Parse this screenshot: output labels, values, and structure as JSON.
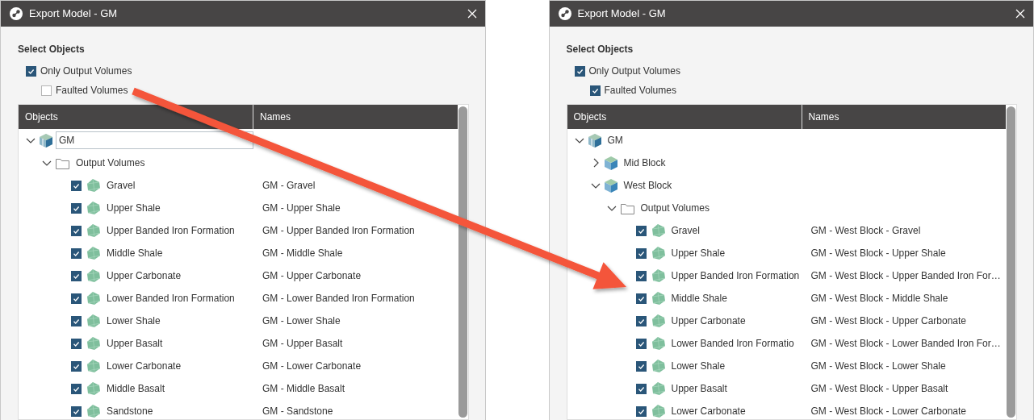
{
  "dialogs": [
    {
      "title": "Export Model - GM",
      "section": "Select Objects",
      "options": [
        {
          "label": "Only Output Volumes",
          "checked": true,
          "children": [
            {
              "label": "Faulted Volumes",
              "checked": false
            }
          ]
        }
      ],
      "columns": [
        "Objects",
        "Names"
      ],
      "tree": [
        {
          "kind": "model",
          "label": "GM",
          "expanded": true,
          "selected": true,
          "children": [
            {
              "kind": "folder",
              "label": "Output Volumes",
              "expanded": true,
              "selected": false,
              "children": [
                {
                  "kind": "volume",
                  "label": "Gravel",
                  "name": "GM - Gravel",
                  "checked": true,
                  "selected": false
                },
                {
                  "kind": "volume",
                  "label": "Upper Shale",
                  "name": "GM - Upper Shale",
                  "checked": true,
                  "selected": false
                },
                {
                  "kind": "volume",
                  "label": "Upper Banded Iron Formation",
                  "name": "GM - Upper Banded Iron Formation",
                  "checked": true,
                  "selected": false
                },
                {
                  "kind": "volume",
                  "label": "Middle Shale",
                  "name": "GM - Middle Shale",
                  "checked": true,
                  "selected": false
                },
                {
                  "kind": "volume",
                  "label": "Upper Carbonate",
                  "name": "GM - Upper Carbonate",
                  "checked": true,
                  "selected": false
                },
                {
                  "kind": "volume",
                  "label": "Lower Banded Iron Formation",
                  "name": "GM - Lower Banded Iron Formation",
                  "checked": true,
                  "selected": false
                },
                {
                  "kind": "volume",
                  "label": "Lower Shale",
                  "name": "GM - Lower Shale",
                  "checked": true,
                  "selected": false
                },
                {
                  "kind": "volume",
                  "label": "Upper Basalt",
                  "name": "GM - Upper Basalt",
                  "checked": true,
                  "selected": false
                },
                {
                  "kind": "volume",
                  "label": "Lower Carbonate",
                  "name": "GM - Lower Carbonate",
                  "checked": true,
                  "selected": false
                },
                {
                  "kind": "volume",
                  "label": "Middle Basalt",
                  "name": "GM - Middle Basalt",
                  "checked": true,
                  "selected": false
                },
                {
                  "kind": "volume",
                  "label": "Sandstone",
                  "name": "GM - Sandstone",
                  "checked": true,
                  "selected": false
                }
              ]
            }
          ]
        }
      ]
    },
    {
      "title": "Export Model - GM",
      "section": "Select Objects",
      "options": [
        {
          "label": "Only Output Volumes",
          "checked": true,
          "children": [
            {
              "label": "Faulted Volumes",
              "checked": true
            }
          ]
        }
      ],
      "columns": [
        "Objects",
        "Names"
      ],
      "tree": [
        {
          "kind": "model",
          "label": "GM",
          "expanded": true,
          "selected": false,
          "children": [
            {
              "kind": "block",
              "label": "Mid Block",
              "expanded": false,
              "selected": false
            },
            {
              "kind": "block",
              "label": "West Block",
              "expanded": true,
              "selected": false,
              "children": [
                {
                  "kind": "folder",
                  "label": "Output Volumes",
                  "expanded": true,
                  "selected": false,
                  "children": [
                    {
                      "kind": "volume",
                      "label": "Gravel",
                      "name": "GM - West Block - Gravel",
                      "checked": true,
                      "selected": false
                    },
                    {
                      "kind": "volume",
                      "label": "Upper Shale",
                      "name": "GM - West Block - Upper Shale",
                      "checked": true,
                      "selected": false
                    },
                    {
                      "kind": "volume",
                      "label": "Upper Banded Iron Formation",
                      "name": "GM - West Block - Upper Banded Iron For…",
                      "checked": true,
                      "selected": false
                    },
                    {
                      "kind": "volume",
                      "label": "Middle Shale",
                      "name": "GM - West Block - Middle Shale",
                      "checked": true,
                      "selected": false
                    },
                    {
                      "kind": "volume",
                      "label": "Upper Carbonate",
                      "name": "GM - West Block - Upper Carbonate",
                      "checked": true,
                      "selected": false
                    },
                    {
                      "kind": "volume",
                      "label": "Lower Banded Iron Formatio",
                      "name": "GM - West Block - Lower Banded Iron For…",
                      "checked": true,
                      "selected": false
                    },
                    {
                      "kind": "volume",
                      "label": "Lower Shale",
                      "name": "GM - West Block - Lower Shale",
                      "checked": true,
                      "selected": false
                    },
                    {
                      "kind": "volume",
                      "label": "Upper Basalt",
                      "name": "GM - West Block - Upper Basalt",
                      "checked": true,
                      "selected": false
                    },
                    {
                      "kind": "volume",
                      "label": "Lower Carbonate",
                      "name": "GM - West Block - Lower Carbonate",
                      "checked": true,
                      "selected": false
                    }
                  ]
                }
              ]
            }
          ]
        }
      ]
    }
  ]
}
